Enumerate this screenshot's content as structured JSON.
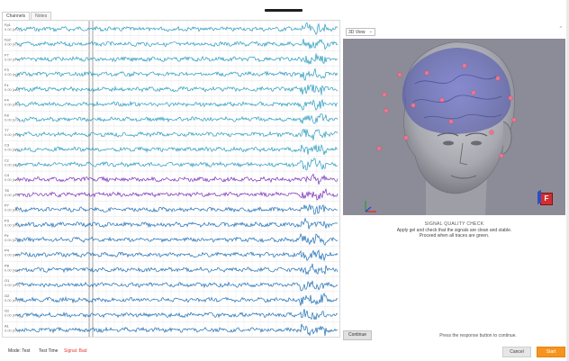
{
  "tabs": [
    {
      "label": "Channels",
      "active": true
    },
    {
      "label": "Notes",
      "active": false
    }
  ],
  "channel_rows": [
    {
      "name": "Fp1",
      "scale": "0.00 [mV]",
      "color": "#2a9bbf"
    },
    {
      "name": "Fp2",
      "scale": "0.00 [mV]",
      "color": "#2a9bbf"
    },
    {
      "name": "F7",
      "scale": "0.00 [mV]",
      "color": "#2a9bbf"
    },
    {
      "name": "F3",
      "scale": "0.00 [mV]",
      "color": "#2a9bbf"
    },
    {
      "name": "Fz",
      "scale": "0.00 [mV]",
      "color": "#2a9bbf"
    },
    {
      "name": "F4",
      "scale": "0.00 [mV]",
      "color": "#2a9bbf"
    },
    {
      "name": "F8",
      "scale": "0.00 [mV]",
      "color": "#2a9bbf"
    },
    {
      "name": "T7",
      "scale": "0.00 [mV]",
      "color": "#2a9bbf"
    },
    {
      "name": "C3",
      "scale": "0.00 [mV]",
      "color": "#2a9bbf"
    },
    {
      "name": "Cz",
      "scale": "0.00 [mV]",
      "color": "#2a9bbf"
    },
    {
      "name": "C4",
      "scale": "0.00 [mV]",
      "color": "#7a2fb8"
    },
    {
      "name": "T8",
      "scale": "0.00 [mV]",
      "color": "#7a2fb8"
    },
    {
      "name": "P7",
      "scale": "0.00 [mV]",
      "color": "#1f6fb3"
    },
    {
      "name": "P3",
      "scale": "0.00 [mV]",
      "color": "#1f6fb3"
    },
    {
      "name": "Pz",
      "scale": "0.00 [mV]",
      "color": "#1f6fb3"
    },
    {
      "name": "P4",
      "scale": "0.00 [mV]",
      "color": "#1f6fb3"
    },
    {
      "name": "P8",
      "scale": "0.00 [mV]",
      "color": "#1f6fb3"
    },
    {
      "name": "O1",
      "scale": "0.00 [mV]",
      "color": "#1f6fb3"
    },
    {
      "name": "O2",
      "scale": "0.00 [mV]",
      "color": "#1f6fb3"
    },
    {
      "name": "Oz",
      "scale": "0.00 [mV]",
      "color": "#1f6fb3"
    },
    {
      "name": "A1",
      "scale": "0.00 [mV]",
      "color": "#1f6fb3"
    }
  ],
  "view": {
    "selected": "3D View",
    "colors": {
      "viewport": "#8c8c98",
      "electrode": "#e8788f",
      "front_badge": "#d32f2f"
    }
  },
  "icons": {
    "collapse": "chevron-up-icon",
    "select": "chevron-down-icon",
    "axes": "axes-gizmo-icon",
    "front": "front-face-badge-icon"
  },
  "front_badge_label": "F",
  "signal_quality": {
    "title": "SIGNAL QUALITY CHECK",
    "line1": "Apply gel and check that the signals are clean and stable.",
    "line2": "Proceed when all traces are green."
  },
  "continue_label": "Continue",
  "continue_hint": "Press the response button to continue.",
  "status": {
    "mode": "Mode: Test",
    "time": "Test Time",
    "signal": "Signal: Bad",
    "colors": {
      "bad": "#e53935"
    }
  },
  "buttons": {
    "cancel": "Cancel",
    "start": "Start",
    "colors": {
      "start": "#f7941d"
    }
  }
}
